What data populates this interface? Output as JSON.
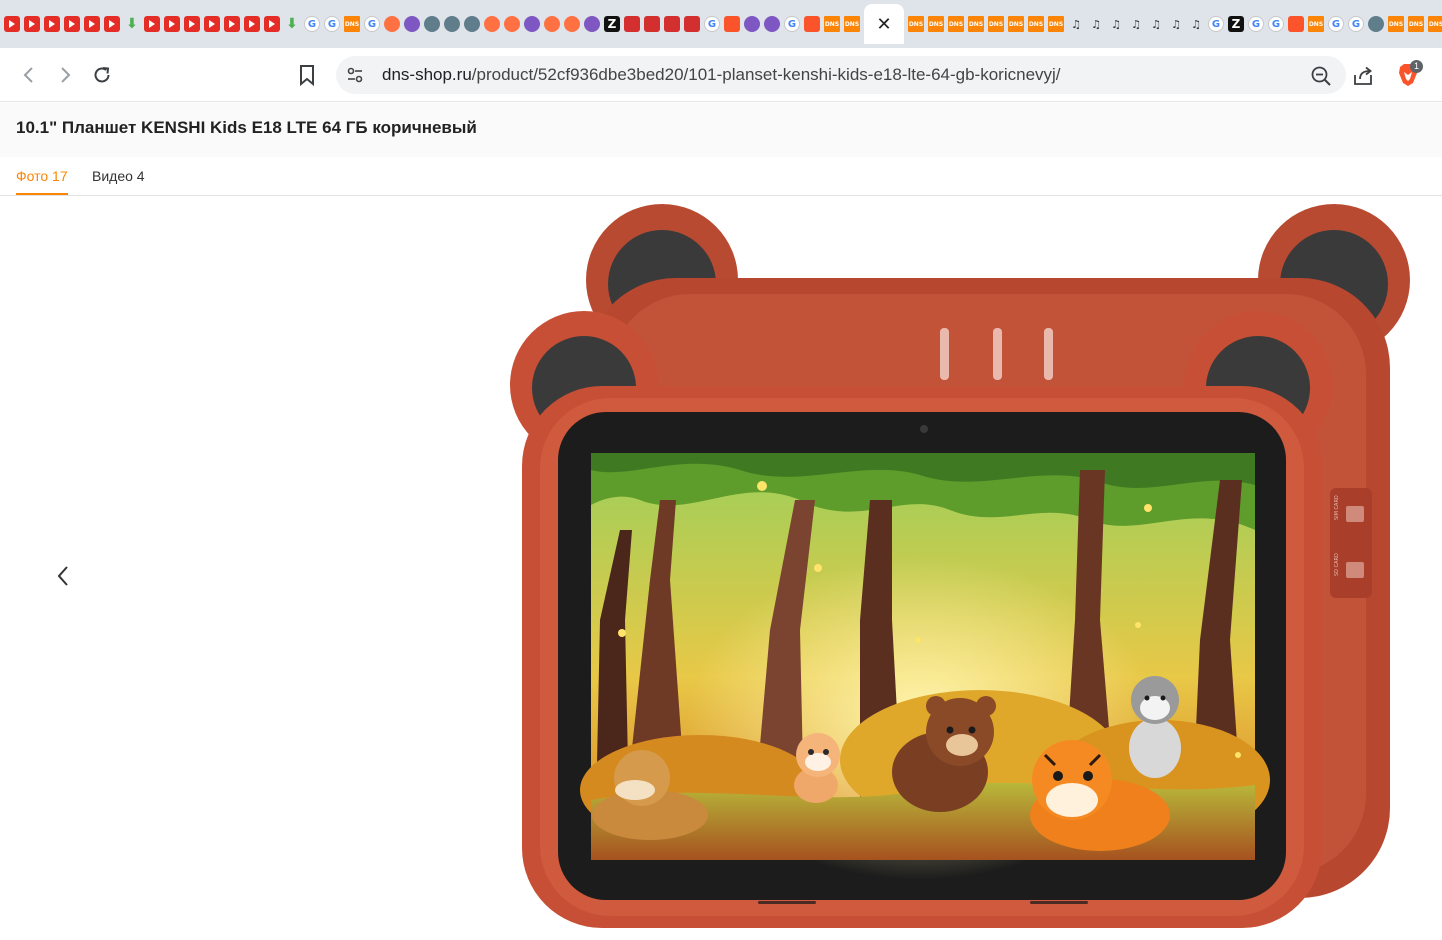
{
  "browser": {
    "tab_favicons": [
      "yt",
      "yt",
      "yt",
      "yt",
      "yt",
      "yt",
      "dl",
      "yt",
      "yt",
      "yt",
      "yt",
      "yt",
      "yt",
      "yt",
      "dl",
      "g",
      "g",
      "dns",
      "g",
      "c1",
      "c2",
      "c3",
      "c3",
      "c3",
      "c1",
      "c1",
      "c2",
      "c1",
      "c1",
      "c2",
      "z",
      "red",
      "red",
      "red",
      "red",
      "g",
      "brave",
      "c2",
      "c2",
      "g",
      "brave",
      "dns",
      "dns"
    ],
    "tab_favicons_right": [
      "dns",
      "dns",
      "dns",
      "dns",
      "dns",
      "dns",
      "dns",
      "dns",
      "n",
      "n",
      "n",
      "n",
      "n",
      "n",
      "n",
      "g",
      "z",
      "g",
      "g",
      "brave",
      "dns",
      "g",
      "g",
      "c3",
      "dns",
      "dns",
      "dns",
      "dns"
    ],
    "active_tab_close": "✕",
    "url_host": "dns-shop.ru",
    "url_path": "/product/52cf936dbe3bed20/101-planset-kenshi-kids-e18-lte-64-gb-koricnevyj/",
    "brave_badge_count": "1"
  },
  "page": {
    "product_title": "10.1\" Планшет KENSHI Kids E18 LTE 64 ГБ коричневый",
    "media_tabs": [
      {
        "label": "Фото 17",
        "active": true
      },
      {
        "label": "Видео 4",
        "active": false
      }
    ],
    "accent_color": "#fc8507",
    "side_labels": [
      "SIM CARD",
      "SD CARD"
    ]
  }
}
